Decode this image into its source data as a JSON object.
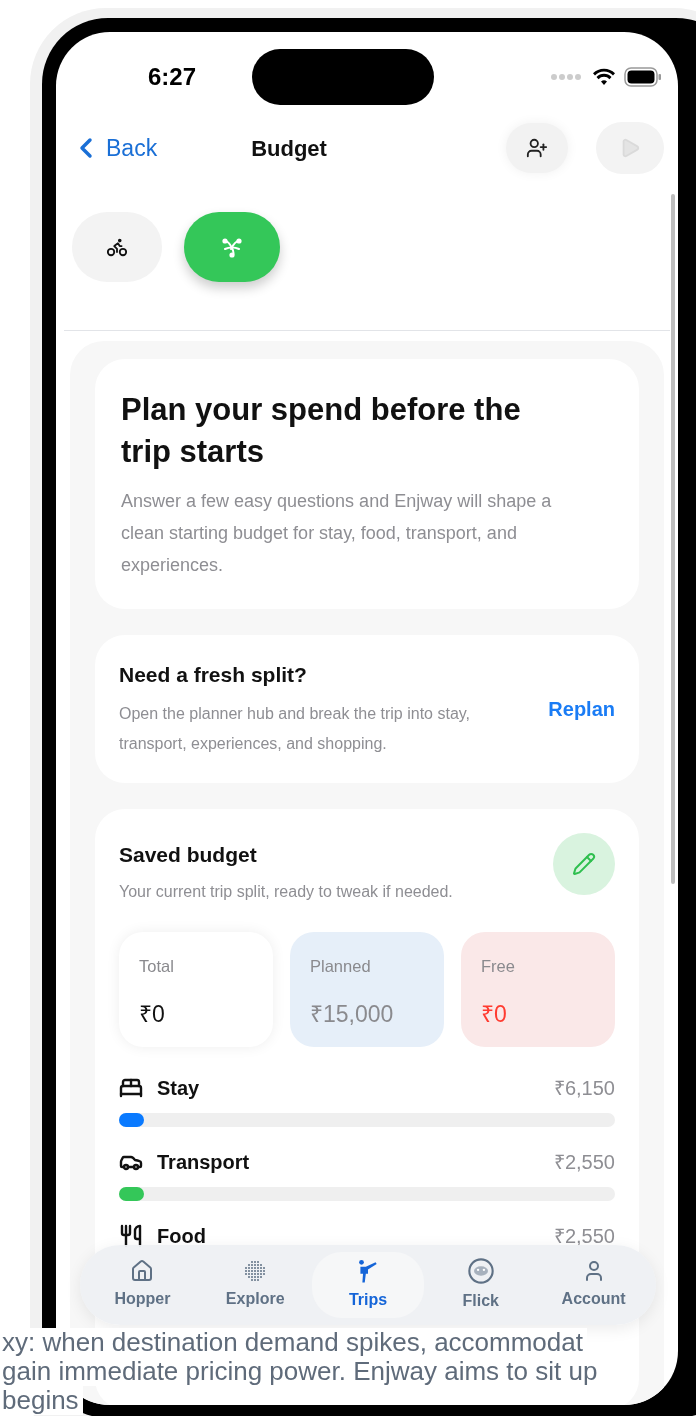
{
  "status_bar": {
    "time": "6:27"
  },
  "nav": {
    "back": "Back",
    "title": "Budget"
  },
  "modes": [
    {
      "kind": "bike",
      "selected": false
    },
    {
      "kind": "cycle",
      "selected": true
    }
  ],
  "hero": {
    "title": "Plan your spend before the trip starts",
    "body": "Answer a few easy questions and Enjway will shape a clean starting budget for stay, food, transport, and experiences."
  },
  "split_card": {
    "title": "Need a fresh split?",
    "body": "Open the planner hub and break the trip into stay, transport, experiences, and shopping.",
    "action": "Replan"
  },
  "saved_budget": {
    "title": "Saved budget",
    "subtitle": "Your current trip split, ready to tweak if needed.",
    "stats": [
      {
        "kind": "total",
        "label": "Total",
        "value": "₹0"
      },
      {
        "kind": "planned",
        "label": "Planned",
        "value": "₹15,000"
      },
      {
        "kind": "free",
        "label": "Free",
        "value": "₹0"
      }
    ],
    "categories": [
      {
        "kind": "stay",
        "name": "Stay",
        "amount": "₹6,150",
        "level": 0.05,
        "color": "#0a7aff"
      },
      {
        "kind": "transport",
        "name": "Transport",
        "amount": "₹2,550",
        "level": 0.05,
        "color": "#34c759"
      },
      {
        "kind": "food",
        "name": "Food",
        "amount": "₹2,550"
      }
    ]
  },
  "tab_bar": [
    {
      "kind": "home",
      "label": "Hopper",
      "selected": false
    },
    {
      "kind": "explore",
      "label": "Explore",
      "selected": false
    },
    {
      "kind": "trips",
      "label": "Trips",
      "selected": true
    },
    {
      "kind": "flick",
      "label": "Flick",
      "selected": false
    },
    {
      "kind": "account",
      "label": "Account",
      "selected": false
    }
  ],
  "overlay_text": [
    "xy: when destination demand spikes, accommodat",
    "gain immediate pricing power. Enjway aims to sit up",
    "begins"
  ]
}
